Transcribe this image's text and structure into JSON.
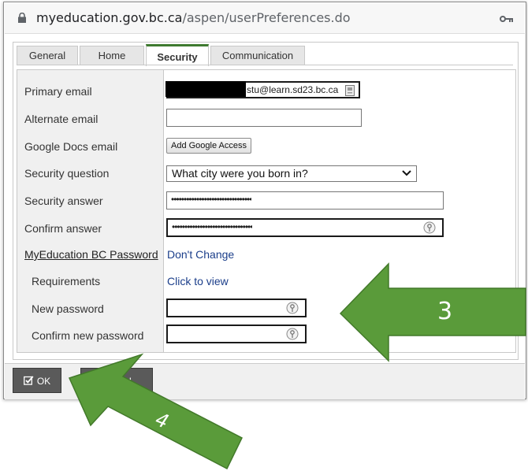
{
  "browser": {
    "url_domain": "myeducation.gov.bc.ca",
    "url_path": "/aspen/userPreferences.do"
  },
  "tabs": [
    {
      "label": "General"
    },
    {
      "label": "Home"
    },
    {
      "label": "Security",
      "active": true
    },
    {
      "label": "Communication"
    }
  ],
  "form": {
    "primary_email": {
      "label": "Primary email",
      "value": "stu@learn.sd23.bc.ca"
    },
    "alternate_email": {
      "label": "Alternate email",
      "value": ""
    },
    "google_docs_email": {
      "label": "Google Docs email",
      "button": "Add Google Access"
    },
    "security_question": {
      "label": "Security question",
      "value": "What city were you born in?"
    },
    "security_answer": {
      "label": "Security answer",
      "value": "••••••••••••••••••••••••••••••••"
    },
    "confirm_answer": {
      "label": "Confirm answer",
      "value": "••••••••••••••••••••••••••••••••"
    },
    "password_section": {
      "label": "MyEducation BC Password",
      "link": "Don't Change"
    },
    "requirements": {
      "label": "Requirements",
      "link": "Click to view"
    },
    "new_password": {
      "label": "New password",
      "value": ""
    },
    "confirm_new_password": {
      "label": "Confirm new password",
      "value": ""
    }
  },
  "footer": {
    "ok_label": "OK",
    "cancel_label": "Cancel"
  },
  "annotations": {
    "arrow_right_number": "3",
    "arrow_left_number": "4",
    "color": "#5a9b3a"
  }
}
